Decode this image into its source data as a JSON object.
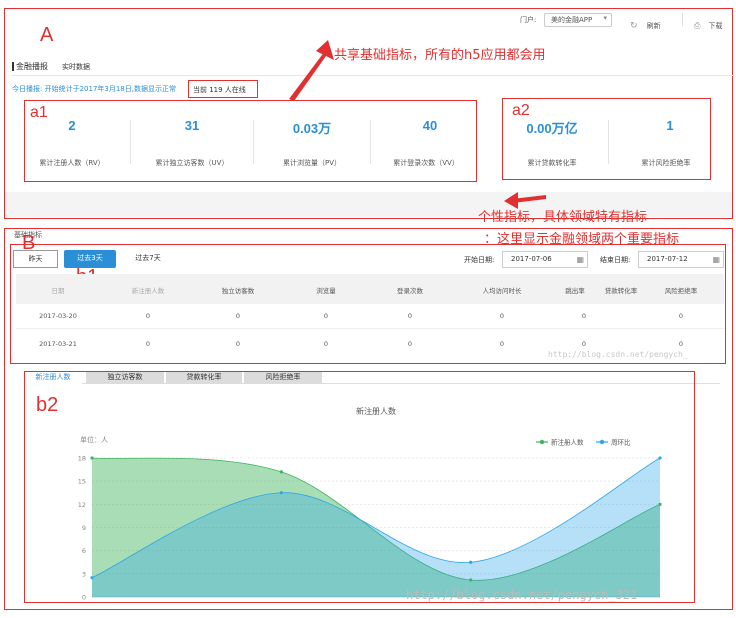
{
  "topbar": {
    "portal_label": "门户:",
    "portal_value": "美的金融APP",
    "refresh_label": "刷新",
    "download_label": "下载"
  },
  "header": {
    "title": "金融播报",
    "subtitle": "实时数据",
    "notice": "今日播报: 开始统计于2017年3月18日,数据显示正常",
    "online": "当前 119 人在线"
  },
  "kpis_shared": [
    {
      "value": "2",
      "label": "累计注册人数（RV）"
    },
    {
      "value": "31",
      "label": "累计独立访客数（UV）"
    },
    {
      "value": "0.03万",
      "label": "累计浏览量（PV）"
    },
    {
      "value": "40",
      "label": "累计登录次数（VV）"
    }
  ],
  "kpis_domain": [
    {
      "value": "0.00万亿",
      "label": "累计贷款转化率"
    },
    {
      "value": "1",
      "label": "累计风险拒绝率"
    }
  ],
  "section": {
    "title": "基础指标"
  },
  "range_buttons": [
    "昨天",
    "过去3天",
    "过去7天"
  ],
  "range_active": 1,
  "date": {
    "start_label": "开始日期:",
    "start_value": "2017-07-06",
    "end_label": "结束日期:",
    "end_value": "2017-07-12"
  },
  "table": {
    "headers": [
      "日期",
      "新注册人数",
      "独立访客数",
      "浏览量",
      "登录次数",
      "人均访问时长",
      "跳出率",
      "贷款转化率",
      "风险拒绝率"
    ],
    "rows": [
      [
        "2017-03-20",
        "0",
        "0",
        "0",
        "0",
        "0",
        "0",
        "0",
        "0"
      ],
      [
        "2017-03-21",
        "0",
        "0",
        "0",
        "0",
        "0",
        "0",
        "0",
        "0"
      ]
    ]
  },
  "chart_tabs": [
    "新注册人数",
    "独立访客数",
    "贷款转化率",
    "风险拒绝率"
  ],
  "chart_tab_active": 0,
  "annotations": {
    "label_A": "A",
    "label_a1": "a1",
    "label_a2": "a2",
    "label_B": "B",
    "label_b1": "b1",
    "label_b2": "b2",
    "note_shared": "共享基础指标，所有的h5应用都会用",
    "note_personal": "个性指标，具体领域特有指标",
    "note_finance": "：这里显示金融领域两个重要指标"
  },
  "watermarks": {
    "w1": "http://blog.csdn.net/pengych_",
    "w2": "http://blog.csdn.net/pengych_321"
  },
  "colors": {
    "accent": "#2a8fd6",
    "annotation_red": "#e03030",
    "series_green": "#3fb35a",
    "series_blue": "#2fa6e8"
  },
  "chart_data": {
    "type": "area",
    "title": "新注册人数",
    "ylabel": "单位：人",
    "yticks": [
      0,
      3,
      6,
      9,
      12,
      15,
      18
    ],
    "ylim": [
      0,
      18
    ],
    "x": [
      0,
      1,
      2,
      3
    ],
    "legend_position": "top-right",
    "series": [
      {
        "name": "新注册人数",
        "color": "#3fb35a",
        "values": [
          18,
          16.2,
          2.2,
          12
        ]
      },
      {
        "name": "周环比",
        "color": "#2fa6e8",
        "values": [
          2.5,
          13.5,
          4.5,
          18
        ]
      }
    ]
  }
}
